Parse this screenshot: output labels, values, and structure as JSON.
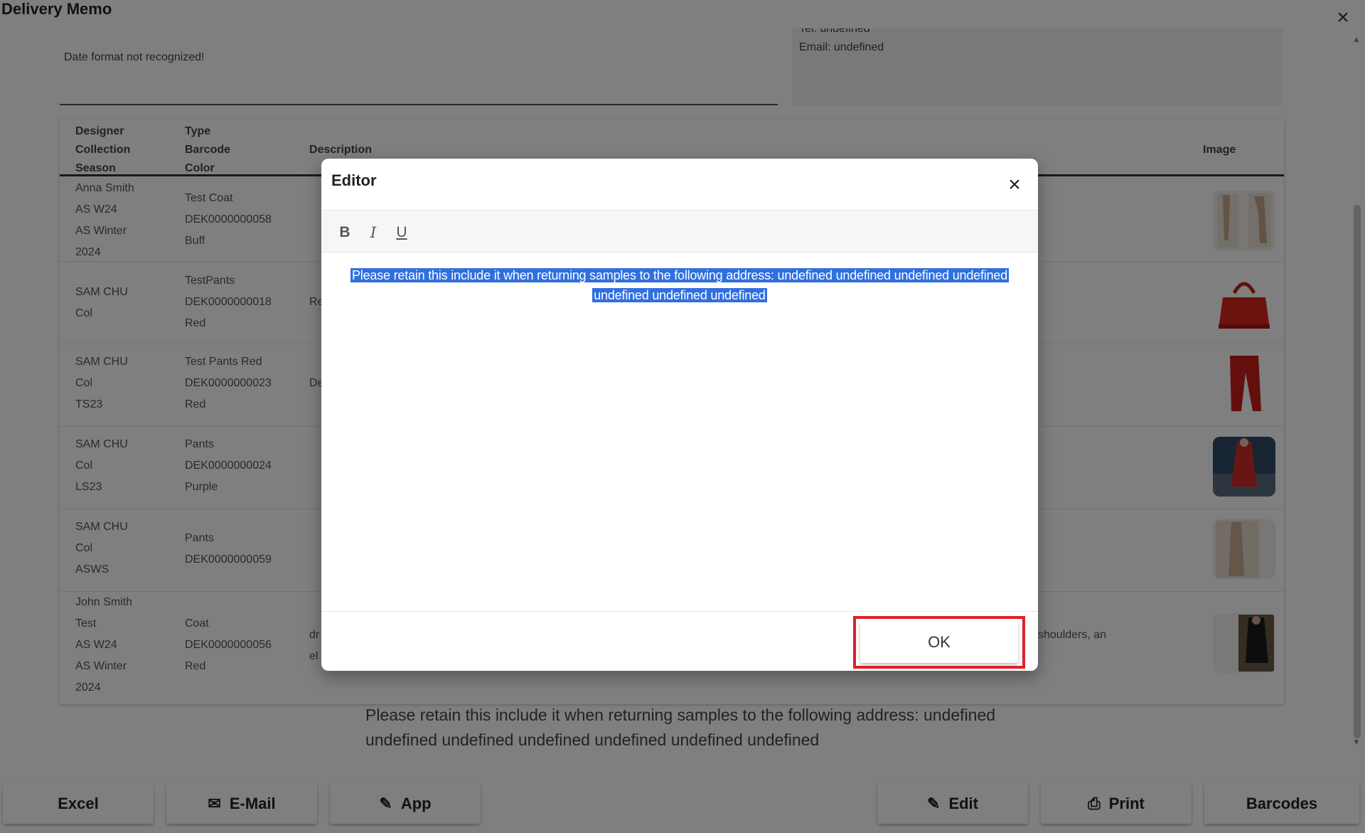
{
  "page": {
    "title": "Delivery Memo",
    "date_warning": "Date format not recognized!",
    "contact": {
      "tel": "Tel: undefined",
      "email": "Email: undefined"
    },
    "table": {
      "headers": {
        "col1": [
          "Designer",
          "Collection",
          "Season"
        ],
        "col2": [
          "Type",
          "Barcode",
          "Color"
        ],
        "description": "Description",
        "image": "Image"
      },
      "rows": [
        {
          "col1": [
            "Anna Smith",
            "AS W24",
            "AS Winter",
            "2024"
          ],
          "col2": [
            "Test Coat",
            "DEK0000000058",
            "Buff"
          ],
          "description": ""
        },
        {
          "col1": [
            "SAM CHU",
            "Col"
          ],
          "col2": [
            "TestPants",
            "DEK0000000018",
            "Red"
          ],
          "description": "Re"
        },
        {
          "col1": [
            "SAM CHU",
            "Col",
            "TS23"
          ],
          "col2": [
            "Test Pants Red",
            "DEK0000000023",
            "Red"
          ],
          "description": "De"
        },
        {
          "col1": [
            "SAM CHU",
            "Col",
            "LS23"
          ],
          "col2": [
            "Pants",
            "DEK0000000024",
            "Purple"
          ],
          "description": ""
        },
        {
          "col1": [
            "SAM CHU",
            "Col",
            "ASWS"
          ],
          "col2": [
            "Pants",
            "DEK0000000059"
          ],
          "description": ""
        },
        {
          "col1": [
            "John Smith",
            "Test",
            "AS W24",
            "AS Winter",
            "2024"
          ],
          "col2": [
            "Coat",
            "DEK0000000056",
            "Red"
          ],
          "description": [
            "dr",
            "el"
          ],
          "description_right": "shoulders, an"
        }
      ]
    },
    "footer_note": "Please retain this include it when returning samples to the following address: undefined undefined undefined undefined undefined undefined undefined",
    "buttons": {
      "excel": "Excel",
      "email": "E-Mail",
      "app": "App",
      "edit": "Edit",
      "print": "Print",
      "barcodes": "Barcodes"
    }
  },
  "dialog": {
    "title": "Editor",
    "toolbar": {
      "bold": "B",
      "italic": "I",
      "underline": "U"
    },
    "content": "Please retain this include it when returning samples to the following address: undefined undefined undefined undefined undefined undefined undefined",
    "ok_label": "OK"
  },
  "colors": {
    "selection": "#2f6fe0",
    "highlight_box": "#e0202a",
    "overlay": "#000000"
  },
  "icons": {
    "close": "close-icon",
    "mail": "mail-icon",
    "pencil": "pencil-icon",
    "printer": "printer-icon"
  }
}
